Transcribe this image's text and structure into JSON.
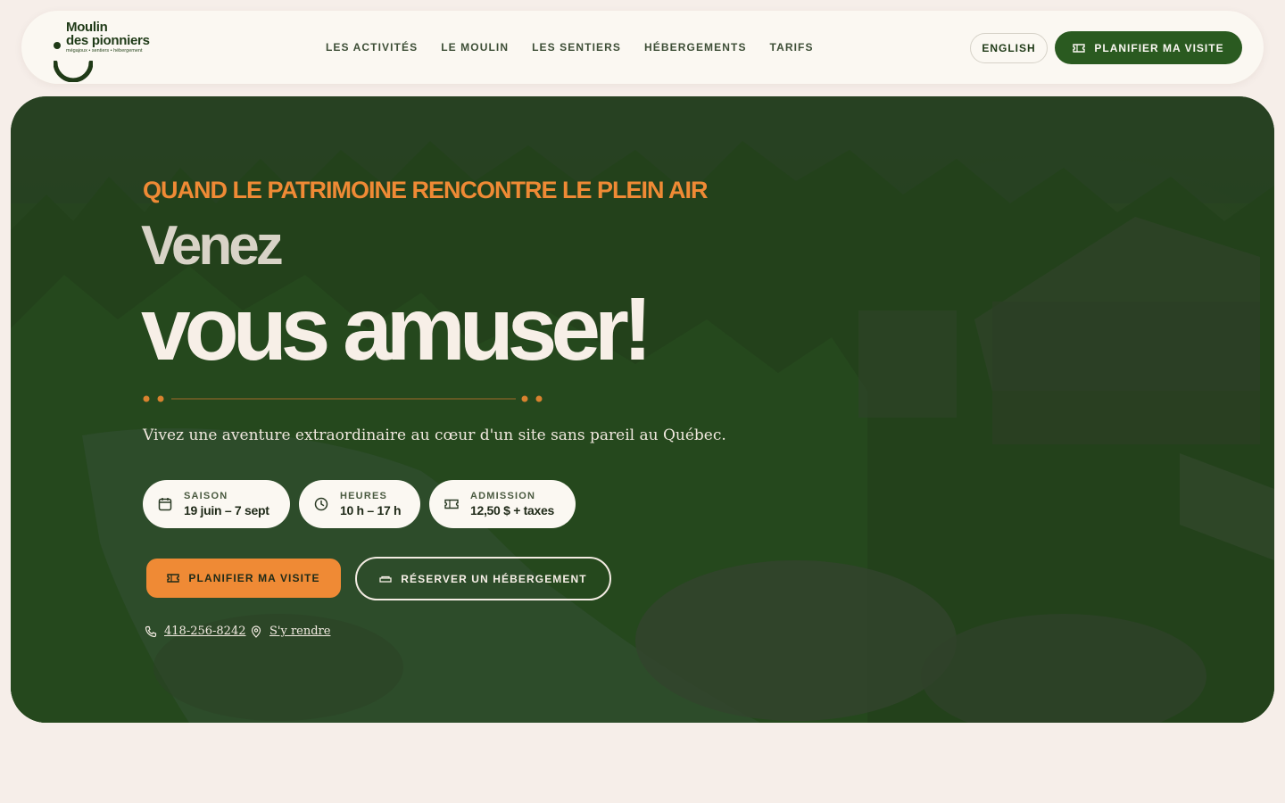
{
  "brand": {
    "line1": "Moulin",
    "line2": "des pionniers",
    "tagline": "mégajoux • sentiers • hébergement"
  },
  "nav": {
    "items": [
      {
        "label": "LES ACTIVITÉS"
      },
      {
        "label": "LE MOULIN"
      },
      {
        "label": "LES SENTIERS"
      },
      {
        "label": "HÉBERGEMENTS"
      },
      {
        "label": "TARIFS"
      }
    ],
    "lang_label": "ENGLISH",
    "plan_label": "PLANIFIER MA VISITE"
  },
  "hero": {
    "kicker": "QUAND LE PATRIMOINE RENCONTRE LE PLEIN AIR",
    "title_line1": "Venez",
    "title_line2": "vous amuser!",
    "subtitle": "Vivez une aventure extraordinaire au cœur d'un site sans pareil au Québec.",
    "info": [
      {
        "label": "SAISON",
        "value": "19 juin – 7 sept",
        "icon": "calendar-icon"
      },
      {
        "label": "HEURES",
        "value": "10 h – 17 h",
        "icon": "clock-icon"
      },
      {
        "label": "ADMISSION",
        "value": "12,50 $ + taxes",
        "icon": "ticket-icon"
      }
    ],
    "cta_plan": "PLANIFIER MA VISITE",
    "cta_reserve": "RÉSERVER UN HÉBERGEMENT",
    "phone": "418-256-8242",
    "directions": "S'y rendre"
  },
  "colors": {
    "accent": "#ef8a35",
    "brand_green": "#2a5a20",
    "background": "#f6eee9",
    "header_bg": "#fbf8f2"
  }
}
